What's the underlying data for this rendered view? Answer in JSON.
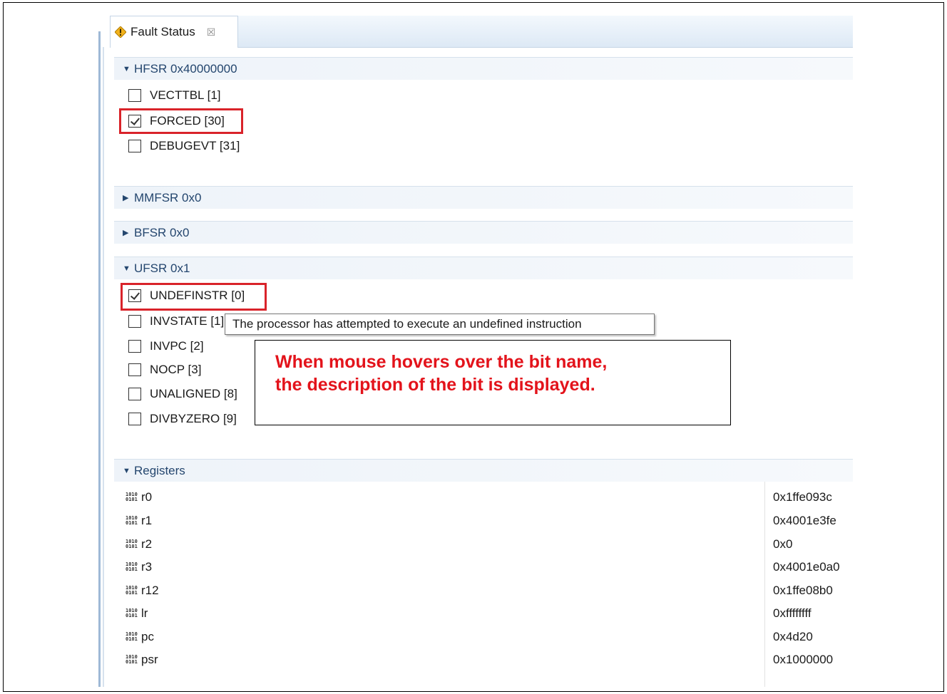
{
  "tab": {
    "title": "Fault Status",
    "close": "☒",
    "icon": "warning-icon"
  },
  "hfsr": {
    "header": "HFSR 0x40000000",
    "bits": [
      {
        "label": "VECTTBL [1]",
        "checked": false
      },
      {
        "label": "FORCED [30]",
        "checked": true
      },
      {
        "label": "DEBUGEVT [31]",
        "checked": false
      }
    ]
  },
  "mmfsr": {
    "header": "MMFSR 0x0"
  },
  "bfsr": {
    "header": "BFSR 0x0"
  },
  "ufsr": {
    "header": "UFSR 0x1",
    "bits": [
      {
        "label": "UNDEFINSTR [0]",
        "checked": true
      },
      {
        "label": "INVSTATE [1]",
        "checked": false
      },
      {
        "label": "INVPC [2]",
        "checked": false
      },
      {
        "label": "NOCP [3]",
        "checked": false
      },
      {
        "label": "UNALIGNED [8]",
        "checked": false
      },
      {
        "label": "DIVBYZERO [9]",
        "checked": false
      }
    ]
  },
  "tooltip": "The processor has attempted to execute an undefined instruction",
  "callout": {
    "line1": "When mouse hovers over the bit name,",
    "line2": "the description of the bit is displayed."
  },
  "registers": {
    "header": "Registers",
    "rows": [
      {
        "name": "r0",
        "value": "0x1ffe093c"
      },
      {
        "name": "r1",
        "value": "0x4001e3fe"
      },
      {
        "name": "r2",
        "value": "0x0"
      },
      {
        "name": "r3",
        "value": "0x4001e0a0"
      },
      {
        "name": "r12",
        "value": "0x1ffe08b0"
      },
      {
        "name": "lr",
        "value": "0xffffffff"
      },
      {
        "name": "pc",
        "value": "0x4d20"
      },
      {
        "name": "psr",
        "value": "0x1000000"
      }
    ]
  },
  "colors": {
    "highlight": "#d9232a",
    "callout_text": "#e3131b",
    "section_text": "#24466e"
  }
}
